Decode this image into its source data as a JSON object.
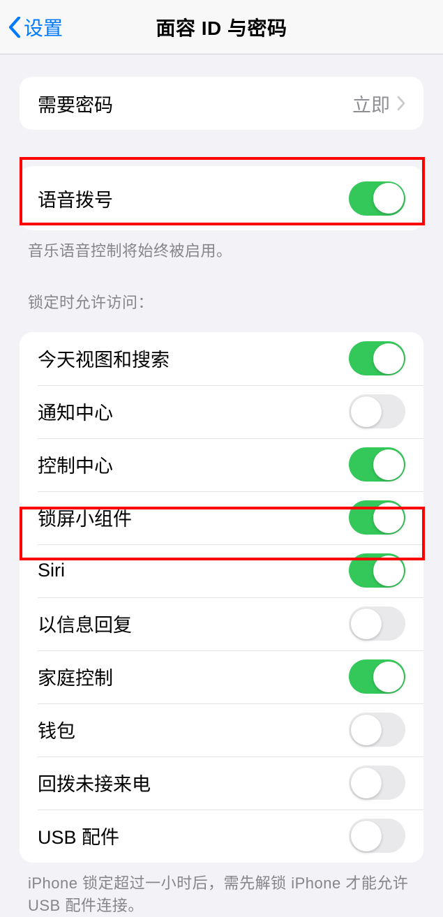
{
  "nav": {
    "back_label": "设置",
    "title": "面容 ID 与密码"
  },
  "require_passcode": {
    "label": "需要密码",
    "value": "立即"
  },
  "voice_dial": {
    "label": "语音拨号",
    "footer": "音乐语音控制将始终被启用。"
  },
  "locked_header": "锁定时允许访问：",
  "locked_items": {
    "today": {
      "label": "今天视图和搜索",
      "on": true
    },
    "notif": {
      "label": "通知中心",
      "on": false
    },
    "control": {
      "label": "控制中心",
      "on": true
    },
    "widgets": {
      "label": "锁屏小组件",
      "on": true
    },
    "siri": {
      "label": "Siri",
      "on": true
    },
    "reply": {
      "label": "以信息回复",
      "on": false
    },
    "home": {
      "label": "家庭控制",
      "on": true
    },
    "wallet": {
      "label": "钱包",
      "on": false
    },
    "callback": {
      "label": "回拨未接来电",
      "on": false
    },
    "usb": {
      "label": "USB 配件",
      "on": false
    }
  },
  "usb_footer": "iPhone 锁定超过一小时后，需先解锁 iPhone 才能允许USB 配件连接。"
}
